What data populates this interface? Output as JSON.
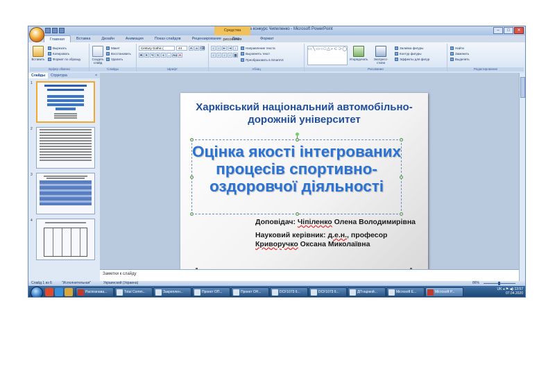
{
  "window": {
    "title": "Презентация на конкурс Чипиленко - Microsoft PowerPoint",
    "contextual_tab": "Средства рисования"
  },
  "ribbon": {
    "tabs": [
      "Главная",
      "Вставка",
      "Дизайн",
      "Анимация",
      "Показ слайдов",
      "Рецензирование",
      "Вид",
      "Формат"
    ],
    "clipboard": {
      "paste": "Вставить",
      "cut": "Вырезать",
      "copy": "Копировать",
      "format_painter": "Формат по образцу",
      "label": "Буфер обмена"
    },
    "slides_group": {
      "new_slide": "Создать слайд",
      "layout": "Макет",
      "reset": "Восстановить",
      "delete": "Удалить",
      "label": "Слайды"
    },
    "font": {
      "name": "Century Gothic (",
      "size": "44",
      "label": "Шрифт"
    },
    "paragraph": {
      "text_direction": "Направление текста",
      "align_text": "Выровнять текст",
      "smartart": "Преобразовать в SmartArt",
      "label": "Абзац"
    },
    "drawing": {
      "arrange": "Упорядочить",
      "quick_styles": "Экспресс-стили",
      "fill": "Заливка фигуры",
      "outline": "Контур фигуры",
      "effects": "Эффекты для фигур",
      "label": "Рисование"
    },
    "editing": {
      "find": "Найти",
      "replace": "Заменить",
      "select": "Выделить",
      "label": "Редактирование"
    }
  },
  "left_pane": {
    "tabs": [
      "Слайды",
      "Структура"
    ],
    "slide_numbers": [
      "1",
      "2",
      "3",
      "4"
    ]
  },
  "slide": {
    "university": "Харківський національний автомобільно-дорожній університет",
    "title": "Оцінка якості інтегрованих процесів спортивно-оздоровчої діяльності",
    "presenter_label": "Доповідач:",
    "presenter_name_1": "Чіпіленко",
    "presenter_name_2": "Олена Володимирівна",
    "supervisor_label": "Науковий керівник:",
    "supervisor_degree": "д.е.н.",
    "supervisor_title": ", професор",
    "supervisor_name_1": "Криворучко",
    "supervisor_name_2": "Оксана Миколаївна"
  },
  "notes": {
    "placeholder": "Заметки к слайду"
  },
  "status": {
    "slide_counter": "Слайд 1 из 6",
    "theme": "\"Исполнительная\"",
    "language": "Украинский (Украина)",
    "zoom": "86%"
  },
  "taskbar": {
    "tasks": [
      "Распознава...",
      "Total Comm...",
      "Закреплен...",
      "Проект ОП...",
      "Проект ОН...",
      "DCF1073 6...",
      "DCF1073 6...",
      "ДП-оцінюй...",
      "Microsoft E...",
      "Microsoft P..."
    ],
    "lang": "UK",
    "time": "13:57",
    "date": "07.04.2020"
  }
}
